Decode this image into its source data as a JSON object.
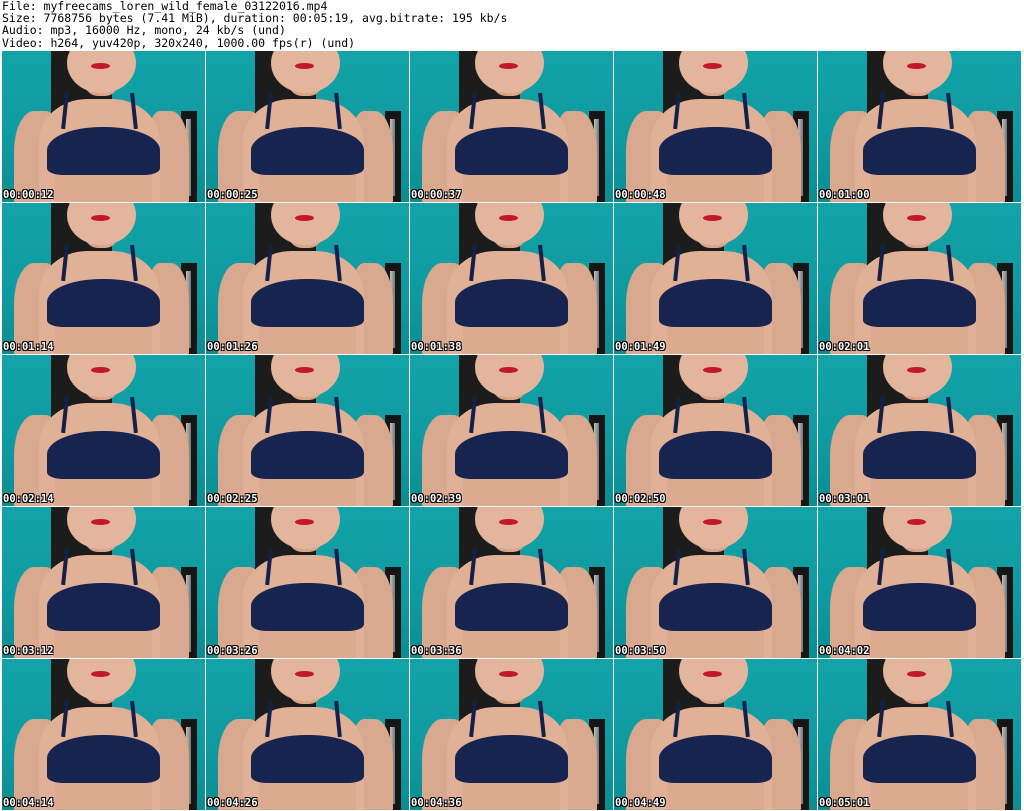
{
  "header": {
    "file_line": "File: myfreecams_loren_wild_female_03122016.mp4",
    "size_line": "Size: 7768756 bytes (7.41 MiB), duration: 00:05:19, avg.bitrate: 195 kb/s",
    "audio_line": "Audio: mp3, 16000 Hz, mono, 24 kb/s (und)",
    "video_line": "Video: h264, yuv420p, 320x240, 1000.00 fps(r) (und)"
  },
  "thumbnails": [
    {
      "timestamp": "00:00:12"
    },
    {
      "timestamp": "00:00:25"
    },
    {
      "timestamp": "00:00:37"
    },
    {
      "timestamp": "00:00:48"
    },
    {
      "timestamp": "00:01:00"
    },
    {
      "timestamp": "00:01:14"
    },
    {
      "timestamp": "00:01:26"
    },
    {
      "timestamp": "00:01:38"
    },
    {
      "timestamp": "00:01:49"
    },
    {
      "timestamp": "00:02:01"
    },
    {
      "timestamp": "00:02:14"
    },
    {
      "timestamp": "00:02:25"
    },
    {
      "timestamp": "00:02:39"
    },
    {
      "timestamp": "00:02:50"
    },
    {
      "timestamp": "00:03:01"
    },
    {
      "timestamp": "00:03:12"
    },
    {
      "timestamp": "00:03:26"
    },
    {
      "timestamp": "00:03:36"
    },
    {
      "timestamp": "00:03:50"
    },
    {
      "timestamp": "00:04:02"
    },
    {
      "timestamp": "00:04:14"
    },
    {
      "timestamp": "00:04:26"
    },
    {
      "timestamp": "00:04:36"
    },
    {
      "timestamp": "00:04:49"
    },
    {
      "timestamp": "00:05:01"
    }
  ],
  "colors": {
    "background_wall": "#12a3a8",
    "top_garment": "#17244f",
    "timestamp_text": "#ffffff"
  }
}
